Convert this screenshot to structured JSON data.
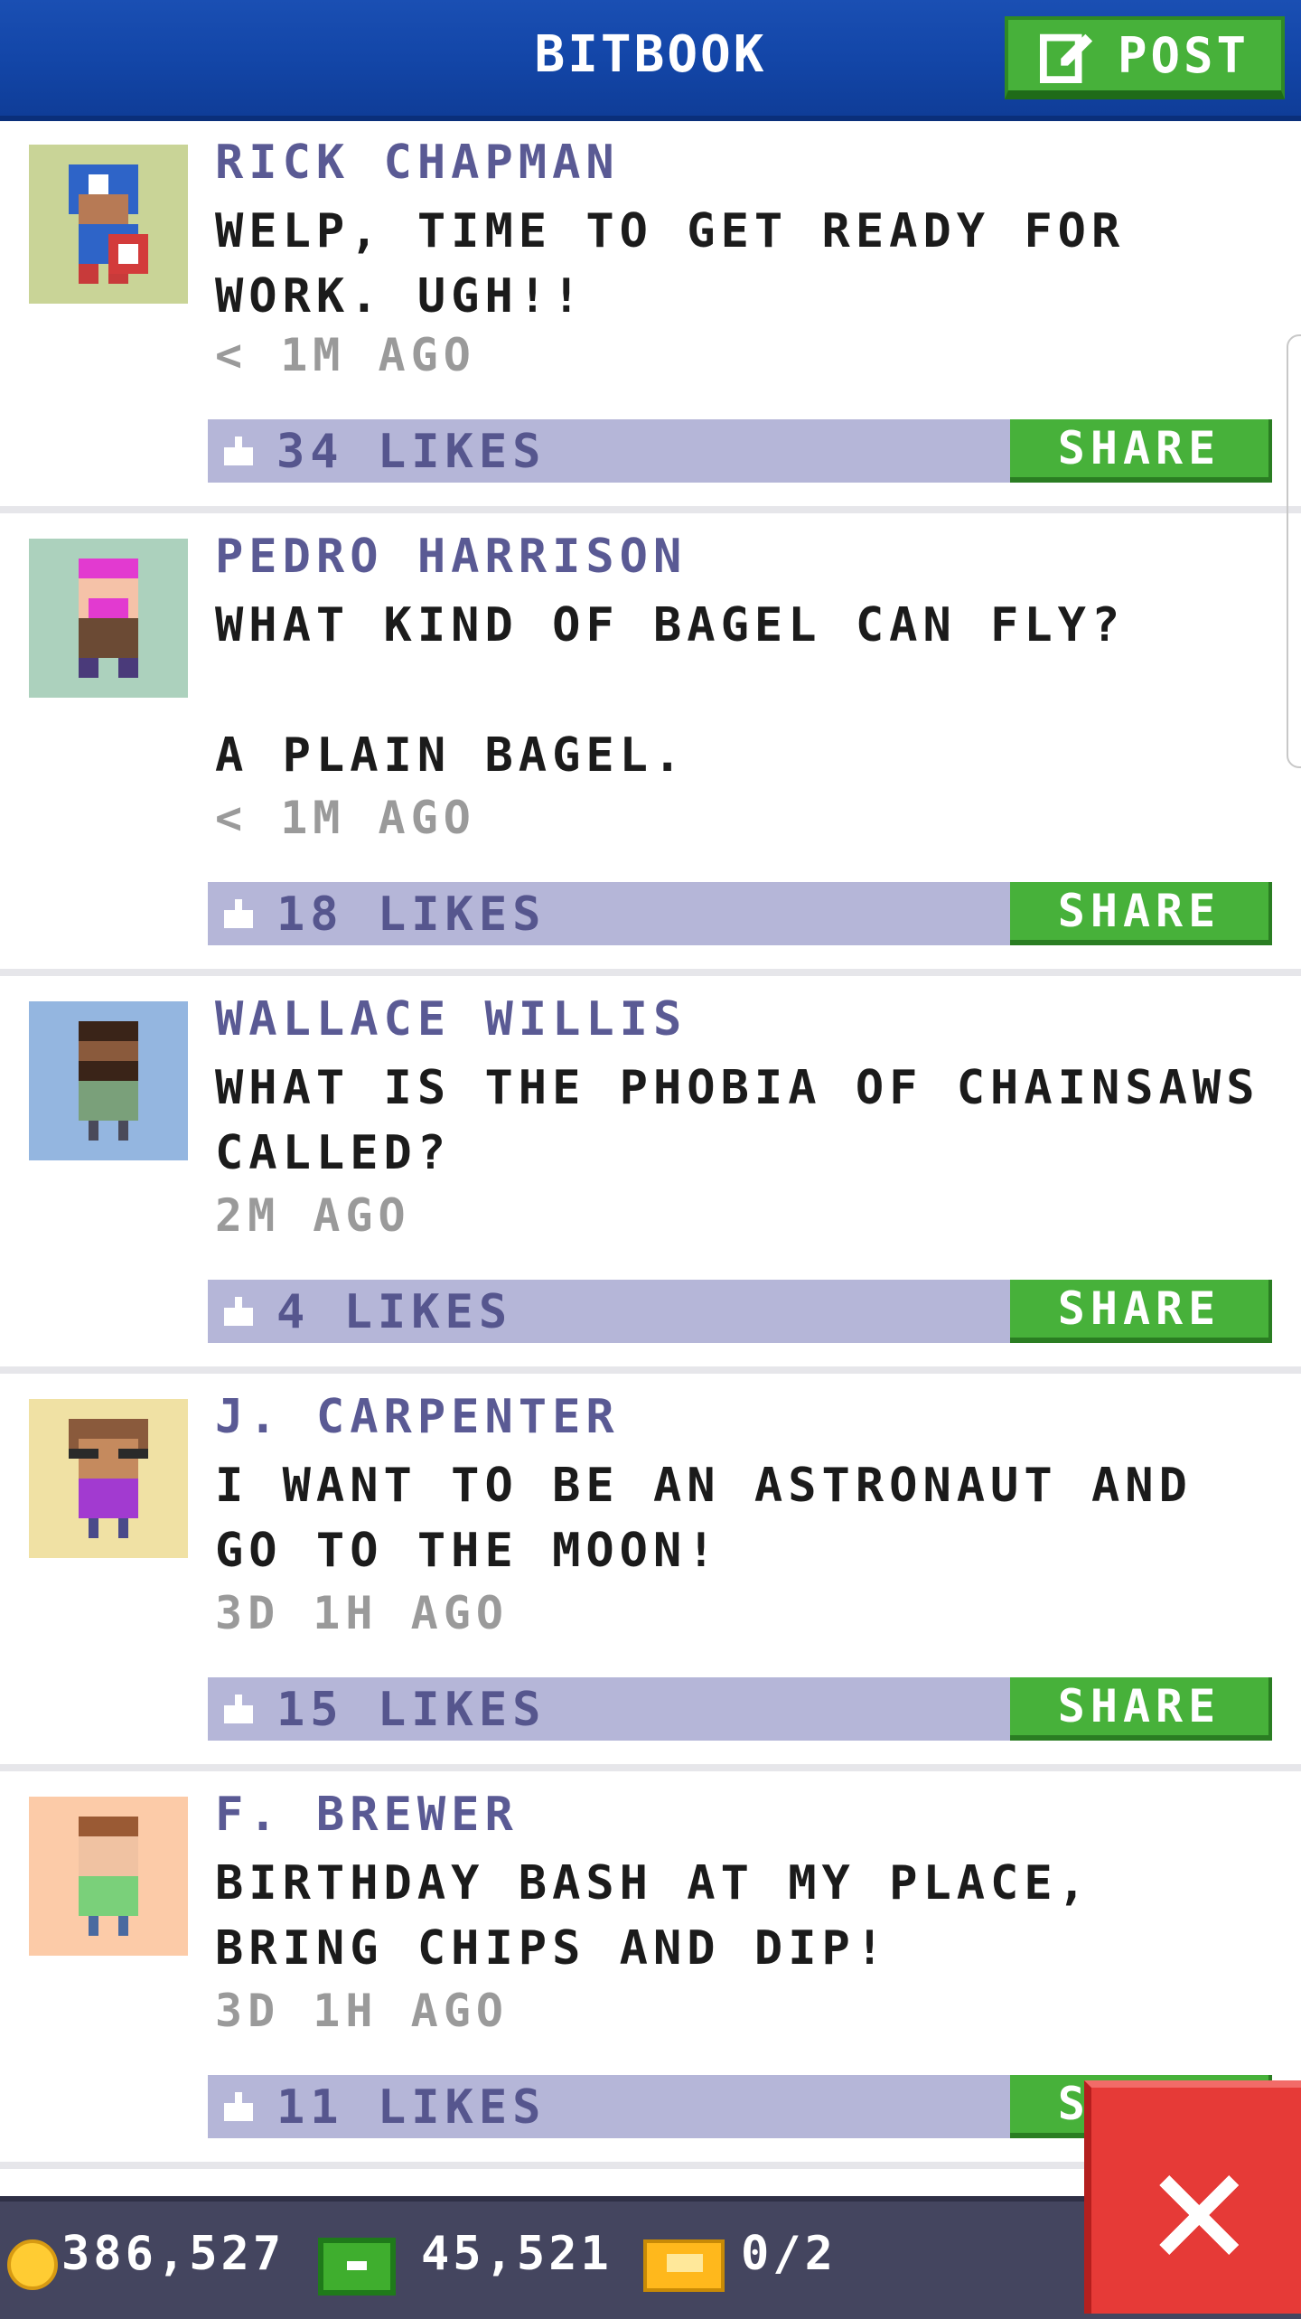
{
  "header": {
    "title": "BITBOOK",
    "post_label": "POST"
  },
  "posts": [
    {
      "name": "RICK CHAPMAN",
      "message": "WELP, TIME TO GET READY FOR WORK. UGH!!",
      "time": "< 1M AGO",
      "likes": "34 LIKES",
      "share": "SHARE",
      "avatar_bg": "#c9d497"
    },
    {
      "name": "PEDRO HARRISON",
      "message": "WHAT KIND OF BAGEL CAN FLY?\n\nA PLAIN BAGEL.",
      "time": "< 1M AGO",
      "likes": "18 LIKES",
      "share": "SHARE",
      "avatar_bg": "#acd1bd"
    },
    {
      "name": "WALLACE WILLIS",
      "message": "WHAT IS THE PHOBIA OF CHAINSAWS CALLED?",
      "time": "2M AGO",
      "likes": "4 LIKES",
      "share": "SHARE",
      "avatar_bg": "#94b6e0"
    },
    {
      "name": "J. CARPENTER",
      "message": "I WANT TO BE AN ASTRONAUT AND GO TO THE MOON!",
      "time": "3D 1H AGO",
      "likes": "15 LIKES",
      "share": "SHARE",
      "avatar_bg": "#f0e1a4"
    },
    {
      "name": "F. BREWER",
      "message": "BIRTHDAY BASH AT MY PLACE, BRING CHIPS AND DIP!",
      "time": "3D 1H AGO",
      "likes": "11 LIKES",
      "share": "SHARE",
      "avatar_bg": "#fccba8"
    }
  ],
  "footer": {
    "coins": "386,527",
    "bux": "45,521",
    "tickets": "0/2"
  },
  "colors": {
    "header": "#1346a8",
    "accent_green": "#47b13a",
    "likebar": "#b5b6d8",
    "name_text": "#5a5a94",
    "close_red": "#e63a37"
  }
}
